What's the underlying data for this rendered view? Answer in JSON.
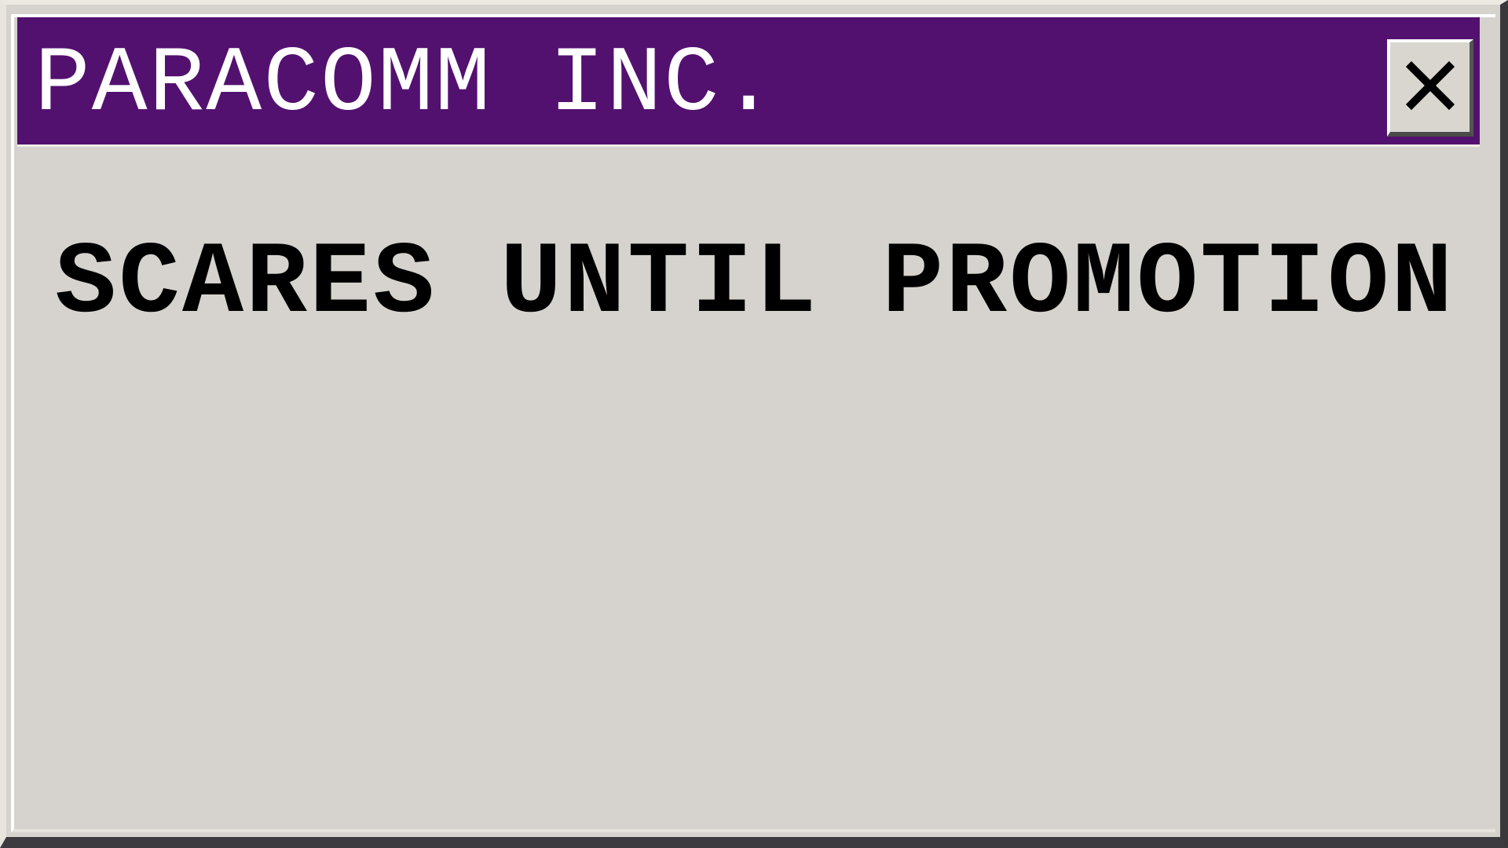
{
  "window": {
    "title": "PARACOMM INC.",
    "close_icon": "close-icon",
    "accent_color": "#53116f"
  },
  "content": {
    "headline": "SCARES UNTIL PROMOTION"
  }
}
